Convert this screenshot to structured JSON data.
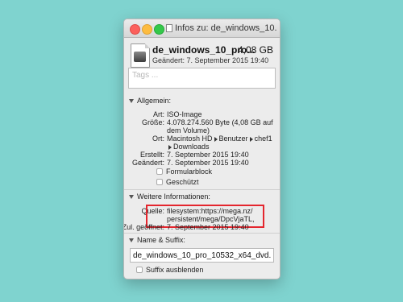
{
  "window": {
    "title": "Infos zu: de_windows_10..."
  },
  "header": {
    "filename": "de_windows_10_pro...",
    "size": "4,08 GB",
    "modified": "Geändert: 7. September 2015 19:40"
  },
  "tags": {
    "placeholder": "Tags ..."
  },
  "general": {
    "heading": "Allgemein:",
    "rows": [
      {
        "label": "Art:",
        "value": "ISO-Image"
      },
      {
        "label": "Größe:",
        "value": "4.078.274.560 Byte (4,08 GB auf dem Volume)"
      },
      {
        "label": "Ort:",
        "path": [
          "Macintosh HD",
          "Benutzer",
          "chef1",
          "Downloads"
        ]
      },
      {
        "label": "Erstellt:",
        "value": "7. September 2015 19:40"
      },
      {
        "label": "Geändert:",
        "value": "7. September 2015 19:40"
      }
    ],
    "checkboxes": [
      {
        "label": "Formularblock",
        "checked": false
      },
      {
        "label": "Geschützt",
        "checked": false
      }
    ]
  },
  "more_info": {
    "heading": "Weitere Informationen:",
    "source_label": "Quelle:",
    "source_line1": "filesystem:https://mega.nz/",
    "source_line2": "persistent/mega/DpcVjaTL,",
    "opened_label": "Zul. geöffnet:",
    "opened_value": "7. September 2015 19:40",
    "highlight_color": "#e4262e"
  },
  "name_suffix": {
    "heading": "Name & Suffix:",
    "value": "de_windows_10_pro_10532_x64_dvd.",
    "hide_suffix_label": "Suffix ausblenden",
    "hide_suffix_checked": false
  },
  "colors": {
    "background": "#7fd3cf",
    "window_bg": "#ececec"
  }
}
